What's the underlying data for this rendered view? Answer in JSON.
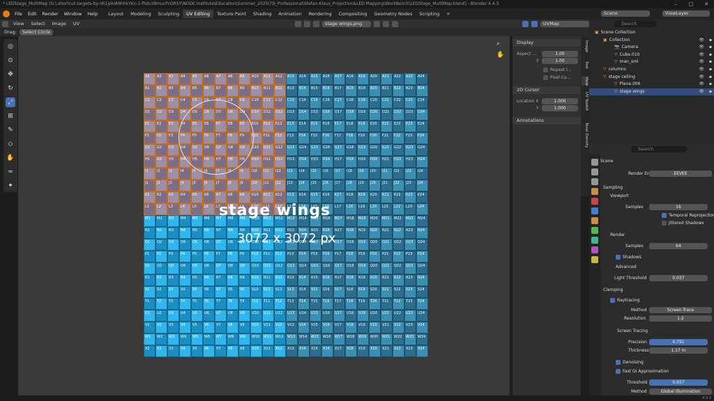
{
  "title": "* LEDStage_MultiMap [G:\\.shortcut-targets-by-id\\1jekIA9hhkYKv-1-fhdv38mucPcGR5Y\\NODE Institute\\Education\\Summer_2025\\7D_Professional\\Stefan-Klaus_Projection&LED Mapping\\WorkBench\\LEDStage_MultiMap.blend] - Blender 4.4.3",
  "menu": [
    "File",
    "Edit",
    "Render",
    "Window",
    "Help"
  ],
  "tabs": [
    "Layout",
    "Modeling",
    "Sculpting",
    "UV Editing",
    "Texture Paint",
    "Shading",
    "Animation",
    "Rendering",
    "Compositing",
    "Geometry Nodes",
    "Scripting",
    "+"
  ],
  "active_tab": "UV Editing",
  "scene": "Scene",
  "view_layer": "ViewLayer",
  "uv_header": {
    "menus": [
      "View",
      "Select",
      "Image",
      "UV"
    ],
    "image_name": "stage wings.png",
    "uv_map": "UVMap"
  },
  "toolset": {
    "drag_label": "Drag:",
    "drag_value": "Select Circle"
  },
  "texture": {
    "name": "stage wings",
    "size": "3072 x 3072 px",
    "rows": [
      "A",
      "B",
      "C",
      "D",
      "E",
      "F",
      "G",
      "H",
      "I",
      "J",
      "K",
      "L",
      "M",
      "N",
      "O",
      "P",
      "Q",
      "R",
      "S",
      "T",
      "U",
      "V",
      "W",
      "X"
    ],
    "cols": 24
  },
  "npanel": {
    "display": "Display",
    "aspect_label": "Aspect ...",
    "aspect_x": "1.00",
    "y_label": "Y",
    "aspect_y": "1.00",
    "repeat": "Repeat I...",
    "pixel": "Pixel Co...",
    "cursor": "2D Cursor",
    "loc_label": "Location X",
    "loc_x": "1.000",
    "loc_y": "1.000",
    "annotations": "Annotations"
  },
  "vtabs": [
    "Image",
    "Tool",
    "View",
    "UV Toolkit",
    "Texel Density"
  ],
  "outliner": {
    "search": "Search",
    "rows": [
      {
        "name": "Scene Collection",
        "ind": 8
      },
      {
        "name": "Collection",
        "ind": 20
      },
      {
        "name": "Camera",
        "ind": 36
      },
      {
        "name": "Cube.010",
        "ind": 36
      },
      {
        "name": "man_sml",
        "ind": 36
      },
      {
        "name": "columns",
        "ind": 20
      },
      {
        "name": "stage ceiling",
        "ind": 20
      },
      {
        "name": "Plane.006",
        "ind": 36
      },
      {
        "name": "stage wings",
        "ind": 36
      }
    ]
  },
  "props": {
    "search": "Search",
    "scene": "Scene",
    "render_engine_label": "Render Engine",
    "render_engine": "EEVEE",
    "sampling": "Sampling",
    "viewport": "Viewport",
    "samples_label": "Samples",
    "vp_samples": "16",
    "temporal": "Temporal Reprojection",
    "jittered": "Jittered Shadows",
    "render": "Render",
    "r_samples": "64",
    "shadows": "Shadows",
    "advanced": "Advanced",
    "light_threshold_label": "Light Threshold",
    "light_threshold": "0.037",
    "clamping": "Clamping",
    "raytracing": "Raytracing",
    "method_label": "Method",
    "method": "Screen-Trace",
    "resolution_label": "Resolution",
    "resolution": "1:2",
    "screen_tracing": "Screen Tracing",
    "precision_label": "Precision",
    "precision": "0.791",
    "thickness_label": "Thickness",
    "thickness": "1.17 m",
    "denoising": "Denoising",
    "fast_gi": "Fast GI Approximation",
    "threshold_label": "Threshold",
    "threshold": "0.657",
    "gi_method_label": "Method",
    "gi_method": "Global Illumination"
  },
  "version": "4.4.3",
  "colors": {
    "accent": "#4772b3",
    "orange": "#e87d0d",
    "tile_light": "#2fb6ef",
    "tile_dark": "#1a8fc4"
  }
}
